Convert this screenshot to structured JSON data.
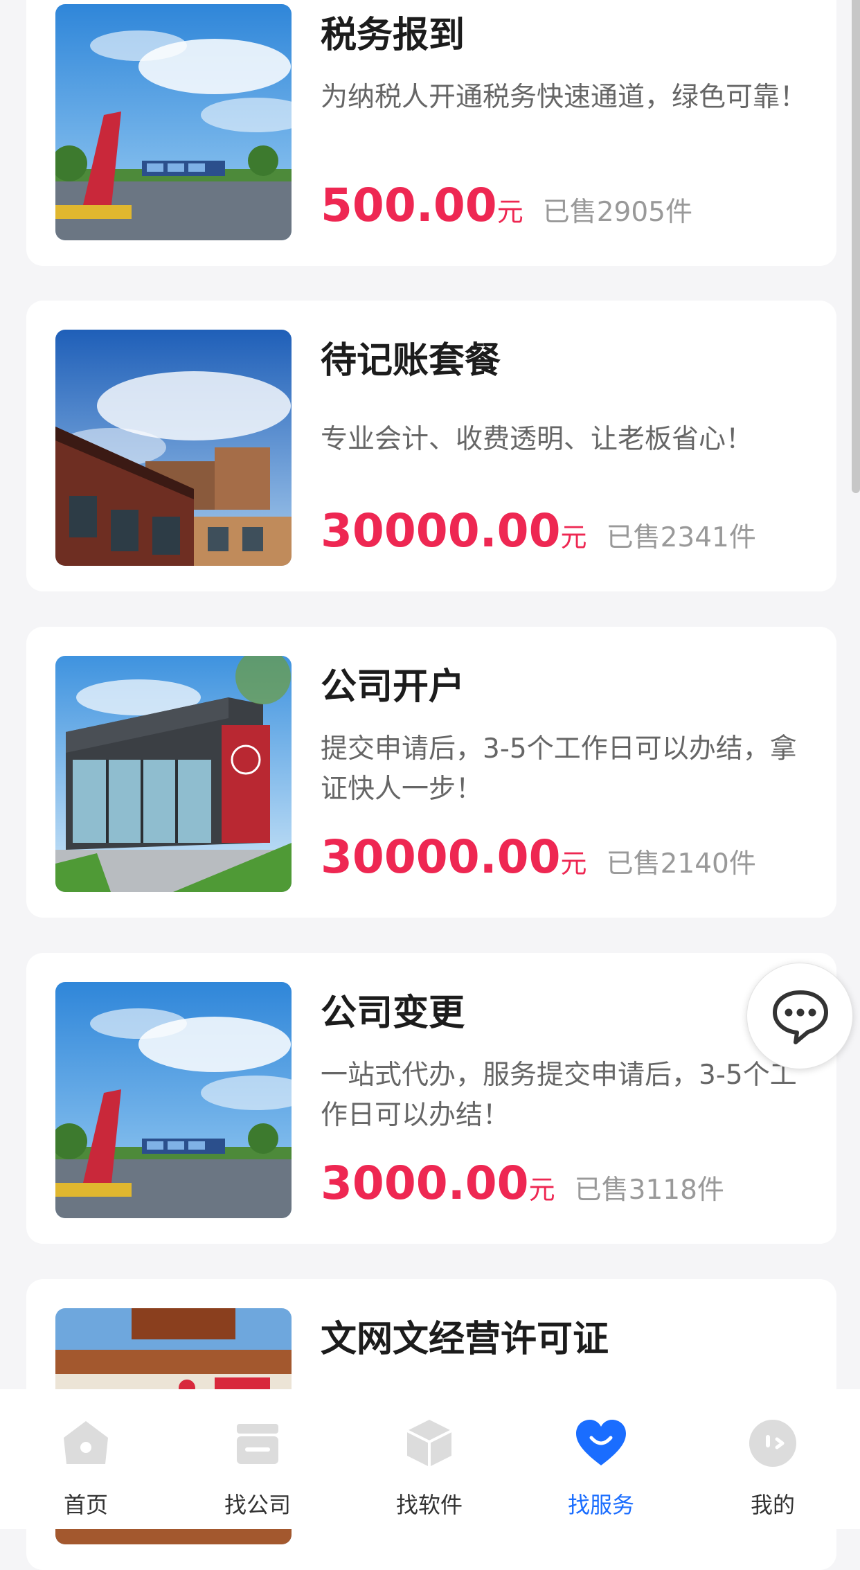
{
  "products": [
    {
      "title": "税务报到",
      "desc": "为纳税人开通税务快速通道，绿色可靠！",
      "price": "500.00",
      "unit": "元",
      "sold": "已售2905件",
      "image": "plaza-photo"
    },
    {
      "title": "待记账套餐",
      "desc": "专业会计、收费透明、让老板省心！",
      "price": "30000.00",
      "unit": "元",
      "sold": "已售2341件",
      "image": "building-photo"
    },
    {
      "title": "公司开户",
      "desc": "提交申请后，3-5个工作日可以办结，拿证快人一步！",
      "price": "30000.00",
      "unit": "元",
      "sold": "已售2140件",
      "image": "storefront-photo"
    },
    {
      "title": "公司变更",
      "desc": "一站式代办，服务提交申请后，3-5个工作日可以办结！",
      "price": "3000.00",
      "unit": "元",
      "sold": "已售3118件",
      "image": "plaza-photo"
    },
    {
      "title": "文网文经营许可证",
      "image": "shop-photo"
    }
  ],
  "chat_button": {
    "icon": "chat-bubble-icon"
  },
  "tabbar": {
    "tabs": [
      {
        "label": "首页",
        "icon": "home-icon",
        "active": false
      },
      {
        "label": "找公司",
        "icon": "store-icon",
        "active": false
      },
      {
        "label": "找软件",
        "icon": "box-icon",
        "active": false
      },
      {
        "label": "找服务",
        "icon": "heart-icon",
        "active": true
      },
      {
        "label": "我的",
        "icon": "profile-face-icon",
        "active": false
      }
    ],
    "active_color": "#1a6dff",
    "inactive_icon_color": "#dcdcdc"
  },
  "colors": {
    "price": "#ee2752",
    "title": "#1c1c1c",
    "desc": "#666666",
    "sold": "#999999",
    "background": "#f5f5f7"
  }
}
